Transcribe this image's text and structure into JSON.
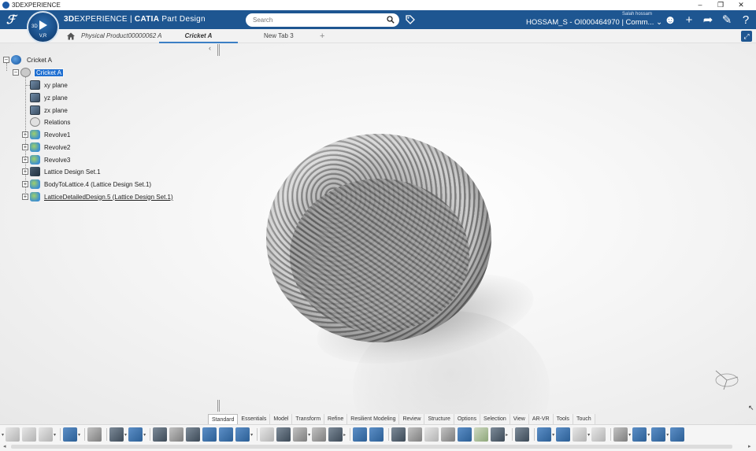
{
  "window": {
    "title": "3DEXPERIENCE",
    "controls": [
      "–",
      "❐",
      "✕"
    ]
  },
  "topbar": {
    "brand_prefix": "3D",
    "brand_middle": "EXPERIENCE",
    "brand_sep": " | ",
    "brand_app": "CATIA",
    "brand_suffix": " Part Design",
    "compass_label": "V,R",
    "compass_3d": "3D",
    "search_placeholder": "Search",
    "user_small": "Salah hossam",
    "user_main": "HOSSAM_S - OI000464970 | Comm... ⌄",
    "icons": [
      "profile-icon",
      "plus-icon",
      "share-icon",
      "tools-icon",
      "help-icon"
    ]
  },
  "tabs": {
    "home": "home-icon",
    "items": [
      {
        "label": "Physical Product00000062 A"
      },
      {
        "label": "Cricket A",
        "active": true
      },
      {
        "label": "New Tab 3"
      }
    ],
    "add_label": "+"
  },
  "tree": {
    "root": "Cricket A",
    "part": "Cricket A",
    "children": [
      {
        "label": "xy plane",
        "icon": "plane-icon",
        "expandable": false
      },
      {
        "label": "yz plane",
        "icon": "plane-icon",
        "expandable": false
      },
      {
        "label": "zx plane",
        "icon": "plane-icon",
        "expandable": false
      },
      {
        "label": "Relations",
        "icon": "relations-icon",
        "expandable": false
      },
      {
        "label": "Revolve1",
        "icon": "revolve-icon",
        "expandable": true
      },
      {
        "label": "Revolve2",
        "icon": "revolve-icon",
        "expandable": true
      },
      {
        "label": "Revolve3",
        "icon": "revolve-icon",
        "expandable": true
      },
      {
        "label": "Lattice Design Set.1",
        "icon": "lattice-set-icon",
        "expandable": true
      },
      {
        "label": "BodyToLattice.4 (Lattice Design Set.1)",
        "icon": "revolve-icon",
        "expandable": true
      },
      {
        "label": "LatticeDetailedDesign.5 (Lattice Design Set.1)",
        "icon": "revolve-icon",
        "expandable": true
      }
    ]
  },
  "sections": [
    "Standard",
    "Essentials",
    "Model",
    "Transform",
    "Refine",
    "Resilient Modeling",
    "Review",
    "Structure",
    "Options",
    "Selection",
    "View",
    "AR-VR",
    "Tools",
    "Touch"
  ],
  "active_section": "Standard"
}
